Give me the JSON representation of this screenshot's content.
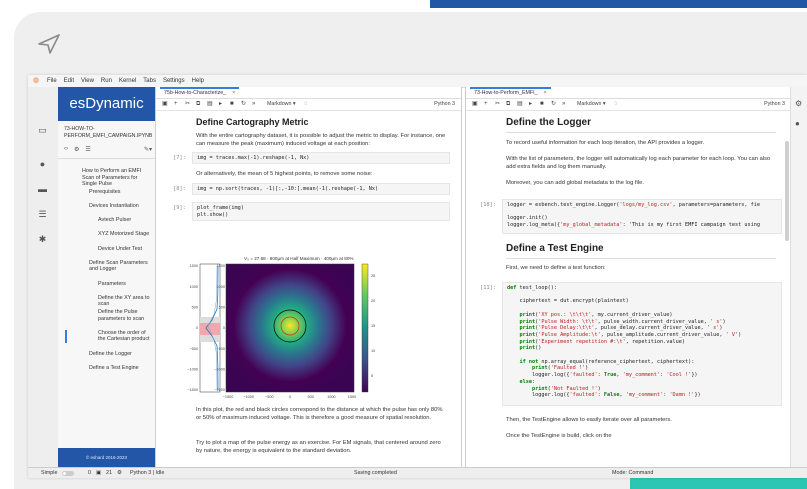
{
  "menu": [
    "File",
    "Edit",
    "View",
    "Run",
    "Kernel",
    "Tabs",
    "Settings",
    "Help"
  ],
  "sidebar": {
    "brand": "esDynamic",
    "filename": "73-How-to-Perform_EMFI_Campaign.ipynb",
    "toc": [
      {
        "label": "How to Perform an EMFI Scan of Parameters for Single Pulse",
        "level": 0
      },
      {
        "label": "Prerequisites",
        "level": 1
      },
      {
        "label": "Devices Instantiation",
        "level": 1
      },
      {
        "label": "Avtech Pulser",
        "level": 2
      },
      {
        "label": "XYZ Motorized Stage",
        "level": 2
      },
      {
        "label": "Device Under Test",
        "level": 2
      },
      {
        "label": "Define Scan Parameters and Logger",
        "level": 1
      },
      {
        "label": "Parameters",
        "level": 2
      },
      {
        "label": "Define the XY area to scan",
        "level": 2
      },
      {
        "label": "Define the Pulse parameters to scan",
        "level": 2
      },
      {
        "label": "Choose the order of the Cartesian product",
        "level": 2
      },
      {
        "label": "Define the Logger",
        "level": 1
      },
      {
        "label": "Define a Test Engine",
        "level": 1
      }
    ],
    "footer": "© eshard 2016-2023"
  },
  "left_nb": {
    "tab": "75b-How-to-Characterize_",
    "kernel": "Python 3",
    "cell_type": "Markdown",
    "heading": "Define Cartography Metric",
    "p1": "With the entire cartography dataset, it is possible to adjust the metric to display. For instance, one can measure the peak (maximum) induced voltage at each position:",
    "prompt7": "[7]:",
    "code7": "img = traces.max(-1).reshape(-1, Nx)",
    "p2": "Or alternatively, the mean of 5 highest points, to remove some noise:",
    "prompt8": "[8]:",
    "code8": "img = np.sort(traces, -1)[:,-10:].mean(-1).reshape(-1, Nx)",
    "prompt9": "[9]:",
    "code9a": "plot_frame(img)",
    "code9b": "plt.show()",
    "p3": "In this plot, the red and black circles correspond to the distance at which the pulse has only 80% or 50% of maximum induced voltage. This is therefore a good measure of spatial resolution.",
    "p4": "Try to plot a map of the pulse energy as an exercise. For EM signals, that centered around zero by nature, the energy is equivalent to the standard deviation."
  },
  "plot": {
    "title": "V₀ = 27.68  ·  800µm at Half Maximum  ·  400µm at 80%",
    "yticks": [
      "1500",
      "1000",
      "500",
      "0",
      "−500",
      "−1000",
      "−1500"
    ],
    "xticks": [
      "−1500",
      "−1000",
      "−500",
      "0",
      "500",
      "1000",
      "1500"
    ],
    "cticks": [
      "25",
      "20",
      "15",
      "10",
      "5"
    ]
  },
  "right_nb": {
    "tab": "73-How-to-Perform_EMFI_",
    "kernel": "Python 3",
    "cell_type": "Markdown",
    "heading1": "Define the Logger",
    "p1": "To record useful information for each loop iteration, the API provides a logger.",
    "p2": "With the list of parameters, the logger will automatically log each parameter for each loop. You can also add extra fields and log them manually.",
    "p3": "Moreover, you can add global metadata to the log file.",
    "prompt18": "[18]:",
    "code18": [
      "logger = esbench.test_engine.Logger('logs/my_log.csv', parameters=parameters, fie",
      "",
      "logger.init()",
      "logger.log_meta({'my_global_metadata': 'This is my first EMFI campaign test using"
    ],
    "heading2": "Define a Test Engine",
    "p4": "First, we need to define a test function:",
    "prompt11": "[11]:",
    "code11": [
      "def test_loop():",
      "",
      "    ciphertext = dut.encrypt(plaintext)",
      "",
      "    print('XY pos.: \\t\\t\\t', my.current_driver_value)",
      "    print('Pulse Width: \\t\\t', pulse_width.current_driver_value, ' s')",
      "    print('Pulse Delay:\\t\\t', pulse_delay.current_driver_value, ' s')",
      "    print('Pulse Amplitude:\\t', pulse_amplitude.current_driver_value, ' V')",
      "    print('Experiment repetition #:\\t', repetition.value)",
      "    print()",
      "",
      "    if not np.array_equal(reference_ciphertext, ciphertext):",
      "        print('Faulted !')",
      "        logger.log({'faulted': True, 'my_comment': 'Cool !'})",
      "    else:",
      "        print('Not Faulted !')",
      "        logger.log({'faulted': False, 'my_comment': 'Damn !'})"
    ],
    "p5": "Then, the TestEngine allows to easily iterate over all parameters.",
    "p6": "Once the TestEngine is build, click on the"
  },
  "status": {
    "mode": "Simple",
    "n1": "0",
    "n2": "21",
    "kernel": "Python 3 | Idle",
    "saving": "Saving completed",
    "cmd": "Mode: Command"
  }
}
